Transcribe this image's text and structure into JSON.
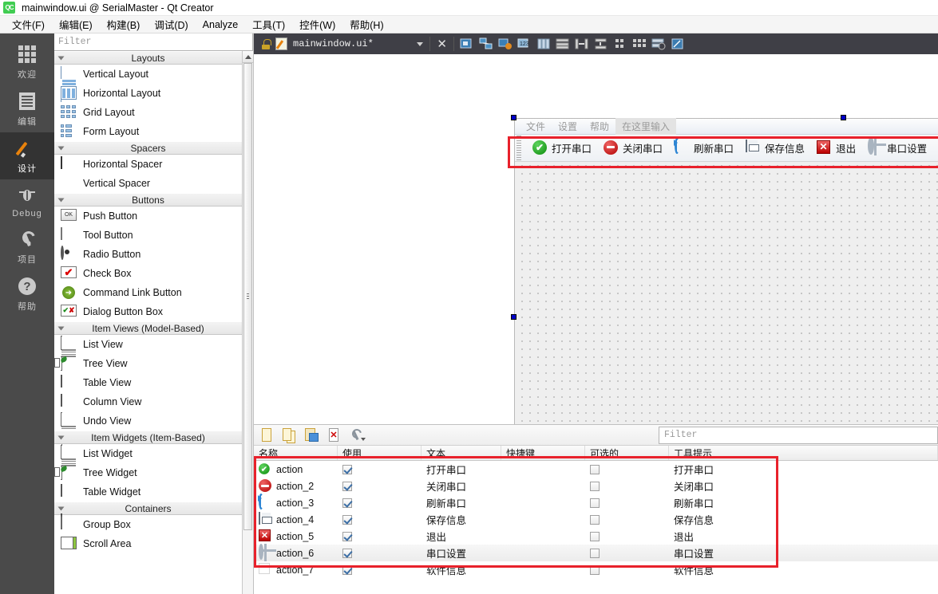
{
  "window": {
    "title": "mainwindow.ui @ SerialMaster - Qt Creator",
    "logo_text": "QC"
  },
  "menubar": {
    "items": [
      {
        "label": "文件(F)"
      },
      {
        "label": "编辑(E)"
      },
      {
        "label": "构建(B)"
      },
      {
        "label": "调试(D)"
      },
      {
        "label": "Analyze"
      },
      {
        "label": "工具(T)"
      },
      {
        "label": "控件(W)"
      },
      {
        "label": "帮助(H)"
      }
    ]
  },
  "modebar": {
    "items": [
      {
        "label": "欢迎",
        "icon": "grid-icon",
        "active": false
      },
      {
        "label": "编辑",
        "icon": "document-lines-icon",
        "active": false
      },
      {
        "label": "设计",
        "icon": "pencil-icon",
        "active": true
      },
      {
        "label": "Debug",
        "icon": "bug-icon",
        "active": false
      },
      {
        "label": "项目",
        "icon": "wrench-icon",
        "active": false
      },
      {
        "label": "帮助",
        "icon": "question-mark-icon",
        "active": false
      }
    ]
  },
  "widgetbox": {
    "filter_placeholder": "Filter",
    "categories": [
      {
        "title": "Layouts",
        "items": [
          {
            "label": "Vertical Layout",
            "icon": "vertical-layout-icon"
          },
          {
            "label": "Horizontal Layout",
            "icon": "horizontal-layout-icon"
          },
          {
            "label": "Grid Layout",
            "icon": "grid-layout-icon"
          },
          {
            "label": "Form Layout",
            "icon": "form-layout-icon"
          }
        ]
      },
      {
        "title": "Spacers",
        "items": [
          {
            "label": "Horizontal Spacer",
            "icon": "horizontal-spacer-icon"
          },
          {
            "label": "Vertical Spacer",
            "icon": "vertical-spacer-icon"
          }
        ]
      },
      {
        "title": "Buttons",
        "items": [
          {
            "label": "Push Button",
            "icon": "push-button-icon"
          },
          {
            "label": "Tool Button",
            "icon": "tool-button-icon"
          },
          {
            "label": "Radio Button",
            "icon": "radio-button-icon"
          },
          {
            "label": "Check Box",
            "icon": "check-box-icon"
          },
          {
            "label": "Command Link Button",
            "icon": "command-link-icon"
          },
          {
            "label": "Dialog Button Box",
            "icon": "dialog-button-box-icon"
          }
        ]
      },
      {
        "title": "Item Views (Model-Based)",
        "items": [
          {
            "label": "List View",
            "icon": "list-view-icon"
          },
          {
            "label": "Tree View",
            "icon": "tree-view-icon"
          },
          {
            "label": "Table View",
            "icon": "table-view-icon"
          },
          {
            "label": "Column View",
            "icon": "column-view-icon"
          },
          {
            "label": "Undo View",
            "icon": "undo-view-icon"
          }
        ]
      },
      {
        "title": "Item Widgets (Item-Based)",
        "items": [
          {
            "label": "List Widget",
            "icon": "list-widget-icon"
          },
          {
            "label": "Tree Widget",
            "icon": "tree-widget-icon"
          },
          {
            "label": "Table Widget",
            "icon": "table-widget-icon"
          }
        ]
      },
      {
        "title": "Containers",
        "items": [
          {
            "label": "Group Box",
            "icon": "group-box-icon"
          },
          {
            "label": "Scroll Area",
            "icon": "scroll-area-icon"
          }
        ]
      }
    ]
  },
  "tabbar": {
    "filename": "mainwindow.ui*",
    "close_glyph": "✕"
  },
  "form": {
    "menubar": [
      {
        "label": "文件",
        "ghost": false
      },
      {
        "label": "设置",
        "ghost": false
      },
      {
        "label": "帮助",
        "ghost": false
      },
      {
        "label": "在这里输入",
        "ghost": true
      }
    ],
    "toolbar": [
      {
        "label": "打开串口",
        "icon": "green-check-circle-icon"
      },
      {
        "label": "关闭串口",
        "icon": "red-minus-circle-icon"
      },
      {
        "label": "刷新串口",
        "icon": "blue-refresh-icon"
      },
      {
        "label": "保存信息",
        "icon": "floppy-save-icon"
      },
      {
        "label": "退出",
        "icon": "red-x-icon"
      },
      {
        "label": "串口设置",
        "icon": "gear-icon"
      }
    ]
  },
  "action_editor": {
    "filter_placeholder": "Filter",
    "toolbar_icons": [
      "new-action-icon",
      "copy-action-icon",
      "paste-action-icon",
      "delete-action-icon",
      "configure-icon"
    ],
    "columns": [
      "名称",
      "使用",
      "文本",
      "快捷键",
      "可选的",
      "工具提示"
    ],
    "rows": [
      {
        "name": "action",
        "icon": "green-check-circle-icon",
        "used": true,
        "text": "打开串口",
        "shortcut": "",
        "checkable": false,
        "tooltip": "打开串口",
        "selected": false
      },
      {
        "name": "action_2",
        "icon": "red-minus-circle-icon",
        "used": true,
        "text": "关闭串口",
        "shortcut": "",
        "checkable": false,
        "tooltip": "关闭串口",
        "selected": false
      },
      {
        "name": "action_3",
        "icon": "blue-refresh-icon",
        "used": true,
        "text": "刷新串口",
        "shortcut": "",
        "checkable": false,
        "tooltip": "刷新串口",
        "selected": false
      },
      {
        "name": "action_4",
        "icon": "floppy-save-icon",
        "used": true,
        "text": "保存信息",
        "shortcut": "",
        "checkable": false,
        "tooltip": "保存信息",
        "selected": false
      },
      {
        "name": "action_5",
        "icon": "red-x-icon",
        "used": true,
        "text": "退出",
        "shortcut": "",
        "checkable": false,
        "tooltip": "退出",
        "selected": false
      },
      {
        "name": "action_6",
        "icon": "gear-icon",
        "used": true,
        "text": "串口设置",
        "shortcut": "",
        "checkable": false,
        "tooltip": "串口设置",
        "selected": true
      },
      {
        "name": "action_7",
        "icon": "blank-icon",
        "used": true,
        "text": "软件信息",
        "shortcut": "",
        "checkable": false,
        "tooltip": "软件信息",
        "selected": false
      }
    ]
  },
  "annotations": {
    "highlight_color": "#e8212b",
    "boxes": [
      {
        "name": "form-toolbar-highlight"
      },
      {
        "name": "action-rows-highlight"
      }
    ]
  }
}
